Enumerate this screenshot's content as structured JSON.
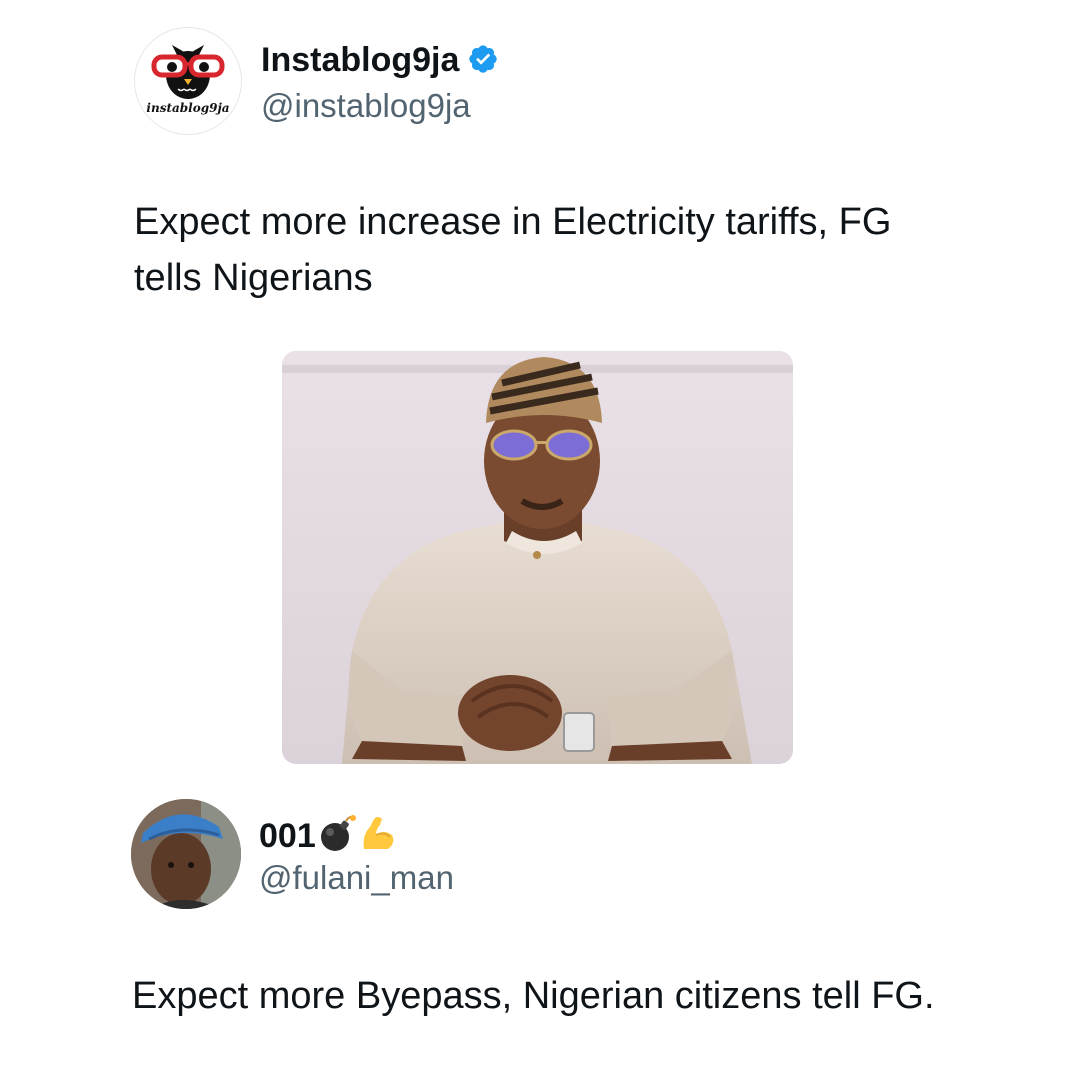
{
  "tweet": {
    "author": {
      "display_name": "Instablog9ja",
      "handle": "@instablog9ja",
      "logo_text": "instablog9ja",
      "verified": true,
      "avatar_icon": "owl-with-red-glasses-logo"
    },
    "text": "Expect more increase in Electricity tariffs, FG tells Nigerians",
    "photo_icon": "man-in-cap-and-glasses-portrait"
  },
  "reply": {
    "author": {
      "display_name": "001",
      "handle": "@fulani_man",
      "emojis": [
        "bomb-icon",
        "flexed-biceps-icon"
      ],
      "avatar_icon": "man-in-blue-cap-avatar"
    },
    "text": "Expect more Byepass, Nigerian citizens tell FG."
  },
  "colors": {
    "verified_blue": "#1d9bf0",
    "secondary_text": "#536471",
    "primary_text": "#0f1419"
  }
}
